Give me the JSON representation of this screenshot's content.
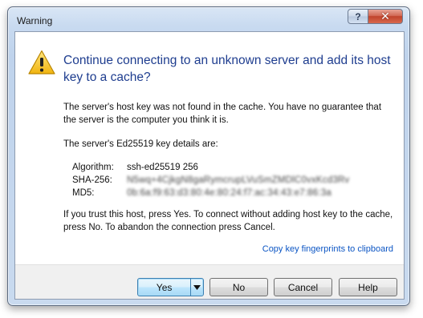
{
  "window": {
    "title": "Warning",
    "help_button": "?",
    "close_button": "✕"
  },
  "content": {
    "heading": "Continue connecting to an unknown server and add its host key to a cache?",
    "paragraph1": "The server's host key was not found in the cache. You have no guarantee that the server is the computer you think it is.",
    "details_intro": "The server's Ed25519 key details are:",
    "details": [
      {
        "label": "Algorithm:",
        "value": "ssh-ed25519 256"
      },
      {
        "label": "SHA-256:",
        "value": "N5wq+4CjkgN8gaRymcrupLVuSmZMDlC0vxKcd3Rv"
      },
      {
        "label": "MD5:",
        "value": "0b:6a:f9:63:d3:80:4e:80:24:f7:ac:34:43:e7:86:3a"
      }
    ],
    "paragraph3": "If you trust this host, press Yes. To connect without adding host key to the cache, press No. To abandon the connection press Cancel.",
    "copy_link": "Copy key fingerprints to clipboard"
  },
  "buttons": {
    "yes": "Yes",
    "yes_dropdown": "▾",
    "no": "No",
    "cancel": "Cancel",
    "help": "Help"
  },
  "icons": {
    "warning": "warning-icon"
  }
}
